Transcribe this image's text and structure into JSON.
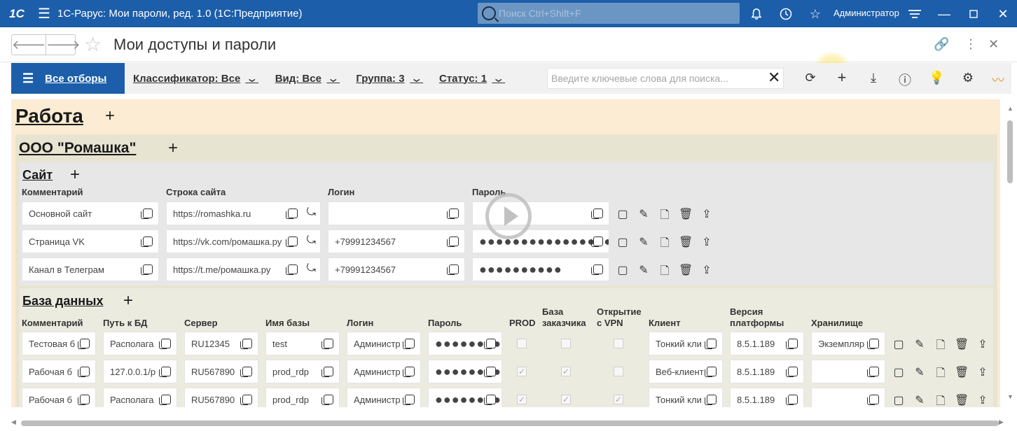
{
  "titlebar": {
    "logo": "1С",
    "title": "1С-Рарус: Мои пароли, ред. 1.0  (1С:Предприятие)",
    "search_placeholder": "Поиск Ctrl+Shift+F",
    "user": "Администратор"
  },
  "form": {
    "title": "Мои доступы и пароли"
  },
  "filters": {
    "all": "Все отборы",
    "items": [
      "Классификатор: Все",
      "Вид: Все",
      "Группа: 3",
      "Статус: 1"
    ],
    "keyword_placeholder": "Введите ключевые слова для поиска..."
  },
  "content": {
    "section": "Работа",
    "org": "ООО \"Ромашка\"",
    "site": {
      "title": "Сайт",
      "headers": [
        "Комментарий",
        "Строка сайта",
        "Логин",
        "Пароль"
      ],
      "rows": [
        {
          "comment": "Основной сайт",
          "url": "https://romashka.ru",
          "login": "",
          "password": ""
        },
        {
          "comment": "Страница VK",
          "url": "https://vk.com/ромашка.ру",
          "login": "+79991234567",
          "password": "●●●●●●●●●●●●●●●●●●●"
        },
        {
          "comment": "Канал в Телеграм",
          "url": "https://t.me/ромашка.ру",
          "login": "+79991234567",
          "password": "●●●●●●●●●●"
        }
      ]
    },
    "db": {
      "title": "База данных",
      "headers": [
        "Комментарий",
        "Путь к БД",
        "Сервер",
        "Имя базы",
        "Логин",
        "Пароль",
        "PROD",
        "База\nзаказчика",
        "Открытие\nс VPN",
        "Клиент",
        "Версия\nплатформы",
        "Хранилище"
      ],
      "rows": [
        {
          "comment": "Тестовая б",
          "path": "Располага",
          "server": "RU12345",
          "name": "test",
          "login": "Администр",
          "password": "●●●●●●●●",
          "prod": false,
          "customer": false,
          "vpn": false,
          "client": "Тонкий кли",
          "version": "8.5.1.189",
          "storage": "Экземпляр"
        },
        {
          "comment": "Рабочая б",
          "path": "127.0.0.1/р",
          "server": "RU567890",
          "name": "prod_rdp",
          "login": "Администр",
          "password": "●●●●●●●●",
          "prod": true,
          "customer": true,
          "vpn": false,
          "client": "Веб-клиент",
          "version": "8.5.1.189",
          "storage": ""
        },
        {
          "comment": "Рабочая б",
          "path": "Располага",
          "server": "RU567890",
          "name": "prod_rdp",
          "login": "Администр",
          "password": "●●●●●●●●",
          "prod": true,
          "customer": true,
          "vpn": true,
          "client": "Тонкий кли",
          "version": "8.5.1.189",
          "storage": ""
        }
      ]
    }
  }
}
